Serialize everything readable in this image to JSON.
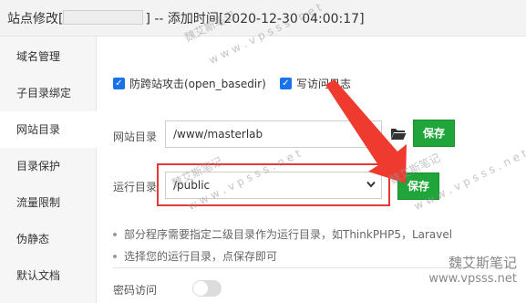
{
  "window": {
    "title_prefix": "站点修改[",
    "title_suffix": "] -- 添加时间[2020-12-30 04:00:17]"
  },
  "sidebar": {
    "items": [
      {
        "label": "域名管理"
      },
      {
        "label": "子目录绑定"
      },
      {
        "label": "网站目录",
        "active": true
      },
      {
        "label": "目录保护"
      },
      {
        "label": "流量限制"
      },
      {
        "label": "伪静态"
      },
      {
        "label": "默认文档"
      }
    ]
  },
  "options": {
    "anti_xss_label": "防跨站攻击(open_basedir)",
    "anti_xss_checked": true,
    "access_log_label": "写访问日志",
    "access_log_checked": true
  },
  "site_dir": {
    "label": "网站目录",
    "value": "/www/masterlab",
    "folder_icon": "folder-icon",
    "save_label": "保存"
  },
  "run_dir": {
    "label": "运行目录",
    "selected": "/public",
    "save_label": "保存"
  },
  "tips": [
    "部分程序需要指定二级目录作为运行目录，如ThinkPHP5，Laravel",
    "选择您的运行目录，点保存即可"
  ],
  "password_access": {
    "label": "密码访问",
    "enabled": false
  },
  "watermarks": {
    "name": "魏艾斯笔记",
    "url": "www.vpsss.net",
    "url_alt": "w w w . v p s s s . n e t"
  },
  "colors": {
    "accent_green": "#20a53a",
    "checkbox_blue": "#1a73e8",
    "highlight_red": "#e53935"
  }
}
